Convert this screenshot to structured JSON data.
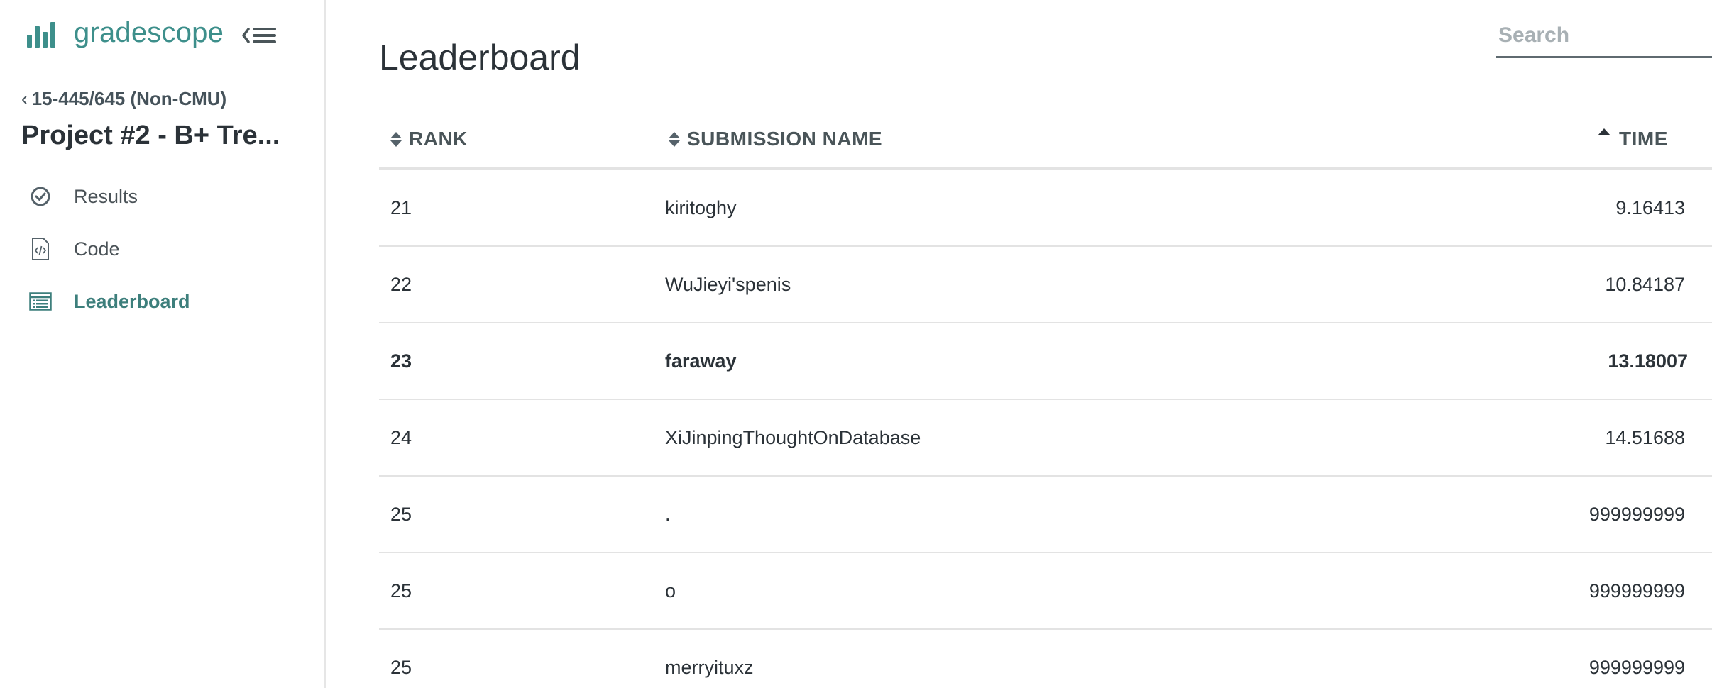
{
  "sidebar": {
    "brand_name": "gradescope",
    "back_label": "15-445/645 (Non-CMU)",
    "assignment_title": "Project #2 - B+ Tre...",
    "nav": [
      {
        "label": "Results",
        "icon": "check-circle-icon",
        "active": false
      },
      {
        "label": "Code",
        "icon": "code-file-icon",
        "active": false
      },
      {
        "label": "Leaderboard",
        "icon": "leaderboard-icon",
        "active": true
      }
    ]
  },
  "main": {
    "title": "Leaderboard",
    "search_placeholder": "Search",
    "columns": {
      "rank": "RANK",
      "name": "SUBMISSION NAME",
      "time": "TIME"
    },
    "rows": [
      {
        "rank": "21",
        "name": "kiritoghy",
        "time": "9.16413",
        "highlight": false
      },
      {
        "rank": "22",
        "name": "WuJieyi'spenis",
        "time": "10.84187",
        "highlight": false
      },
      {
        "rank": "23",
        "name": "faraway",
        "time": "13.18007",
        "highlight": true
      },
      {
        "rank": "24",
        "name": "XiJinpingThoughtOnDatabase",
        "time": "14.51688",
        "highlight": false
      },
      {
        "rank": "25",
        "name": ".",
        "time": "999999999",
        "highlight": false
      },
      {
        "rank": "25",
        "name": "o",
        "time": "999999999",
        "highlight": false
      },
      {
        "rank": "25",
        "name": "merryituxz",
        "time": "999999999",
        "highlight": false
      }
    ]
  },
  "colors": {
    "brand": "#3d8f8b",
    "active_nav": "#3d7f7c",
    "text": "#2b3238"
  }
}
